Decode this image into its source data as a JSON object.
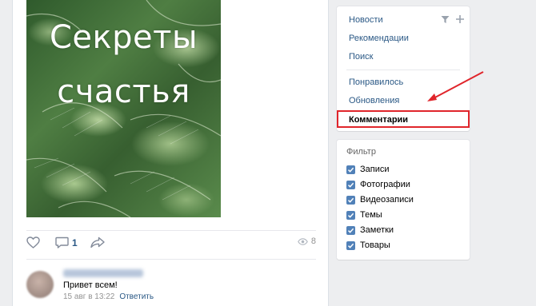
{
  "post": {
    "image_text_line1": "Секреты",
    "image_text_line2": "счастья",
    "comments_count": "1",
    "views_count": "8"
  },
  "comment": {
    "text": "Привет всем!",
    "date": "15 авг в 13:22",
    "reply_label": "Ответить"
  },
  "feed_menu": {
    "items": [
      {
        "label": "Новости"
      },
      {
        "label": "Рекомендации"
      },
      {
        "label": "Поиск"
      },
      {
        "label": "Понравилось"
      },
      {
        "label": "Обновления"
      },
      {
        "label": "Комментарии",
        "active": true
      }
    ],
    "icons": [
      "filter-icon",
      "plus-icon"
    ]
  },
  "filter_panel": {
    "title": "Фильтр",
    "options": [
      {
        "label": "Записи",
        "checked": true
      },
      {
        "label": "Фотографии",
        "checked": true
      },
      {
        "label": "Видеозаписи",
        "checked": true
      },
      {
        "label": "Темы",
        "checked": true
      },
      {
        "label": "Заметки",
        "checked": true
      },
      {
        "label": "Товары",
        "checked": true
      }
    ]
  },
  "colors": {
    "link": "#2a5885",
    "checkbox": "#5181b8",
    "annotation": "#e0252b",
    "background": "#edeef0"
  }
}
